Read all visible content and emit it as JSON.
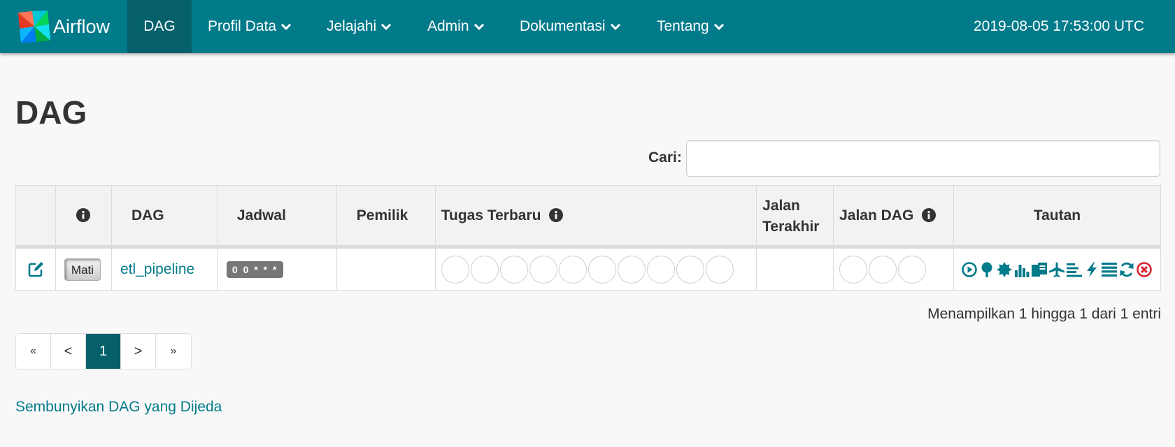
{
  "navbar": {
    "brand": "Airflow",
    "items": [
      {
        "label": "DAG"
      },
      {
        "label": "Profil Data"
      },
      {
        "label": "Jelajahi"
      },
      {
        "label": "Admin"
      },
      {
        "label": "Dokumentasi"
      },
      {
        "label": "Tentang"
      }
    ],
    "time": "2019-08-05 17:53:00 UTC"
  },
  "page": {
    "title": "DAG",
    "search_label": "Cari:",
    "search_value": ""
  },
  "table": {
    "headers": {
      "dag": "DAG",
      "schedule": "Jadwal",
      "owner": "Pemilik",
      "recent_tasks": "Tugas Terbaru",
      "last_run_1": "Jalan",
      "last_run_2": "Terakhir",
      "dag_runs": "Jalan DAG",
      "links": "Tautan"
    },
    "rows": [
      {
        "toggle": "Mati",
        "dag_id": "etl_pipeline",
        "schedule": "0 0 * * *",
        "owner": "",
        "last_run": ""
      }
    ]
  },
  "info": "Menampilkan 1 hingga 1 dari 1 entri",
  "pagination": {
    "first": "«",
    "prev": "<",
    "current": "1",
    "next": ">",
    "last": "»"
  },
  "hide_paused": "Sembunyikan DAG yang Dijeda",
  "colors": {
    "navbar": "#017a8a",
    "nav_active": "#05606c",
    "link": "#017a8a",
    "delete": "#d9232e"
  },
  "icons": [
    "pinwheel-logo",
    "chevron-down-icon",
    "info-circle-icon",
    "edit-icon",
    "play-circle-icon",
    "tree-icon",
    "graph-icon",
    "bar-chart-icon",
    "gantt-duration-icon",
    "plane-landing-icon",
    "align-left-icon",
    "bolt-icon",
    "list-icon",
    "refresh-icon",
    "remove-circle-icon"
  ]
}
